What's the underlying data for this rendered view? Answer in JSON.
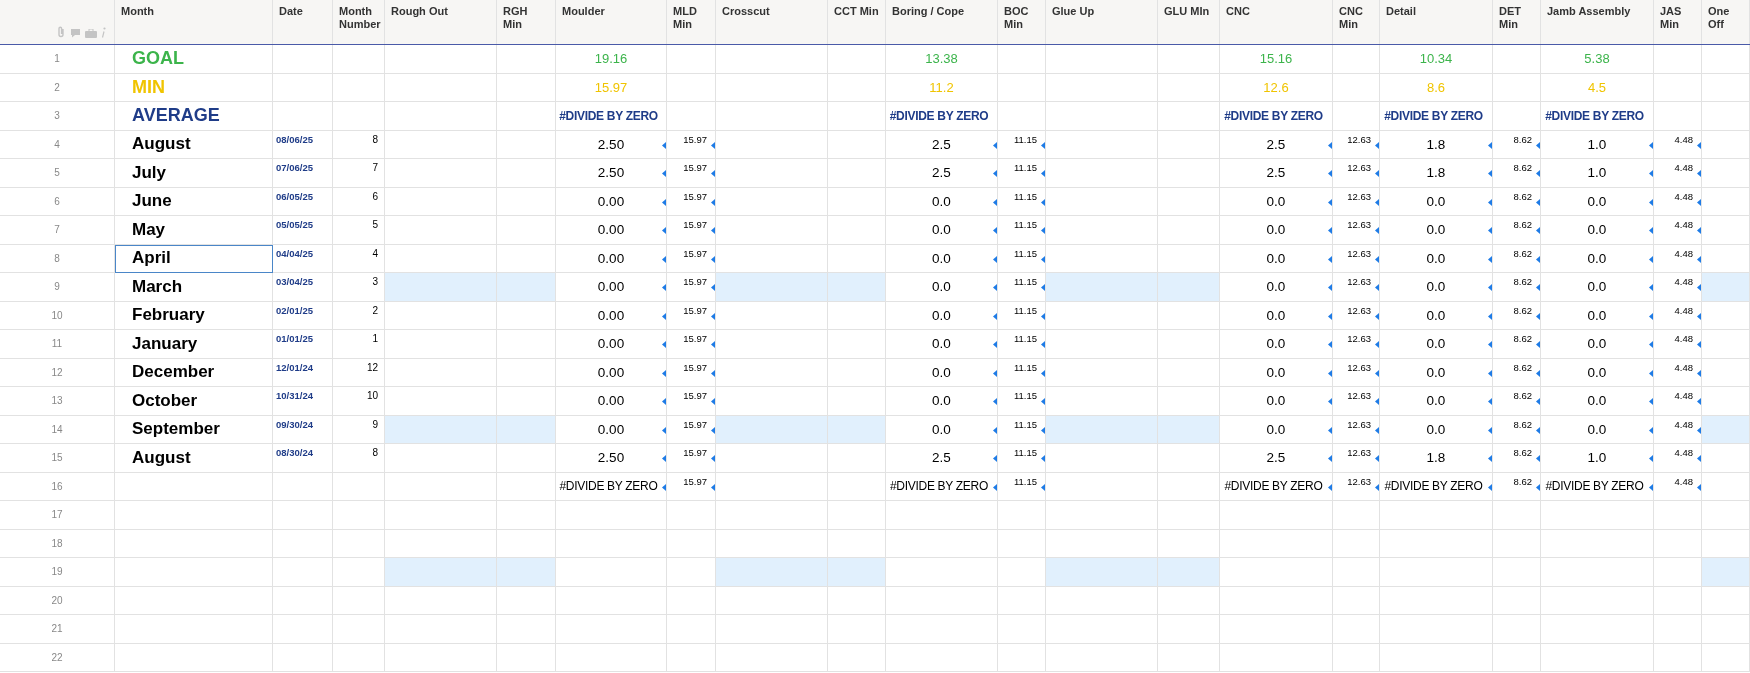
{
  "columns": [
    {
      "label": "Month",
      "kind": "month"
    },
    {
      "label": "Date",
      "kind": "date"
    },
    {
      "label": "Month Number",
      "kind": "number"
    },
    {
      "label": "Rough Out",
      "kind": "blank"
    },
    {
      "label": "RGH Min",
      "kind": "blank"
    },
    {
      "label": "Moulder",
      "kind": "process"
    },
    {
      "label": "MLD Min",
      "kind": "min"
    },
    {
      "label": "Crosscut",
      "kind": "blank"
    },
    {
      "label": "CCT Min",
      "kind": "blank"
    },
    {
      "label": "Boring / Cope",
      "kind": "process"
    },
    {
      "label": "BOC Min",
      "kind": "min"
    },
    {
      "label": "Glue Up",
      "kind": "blank"
    },
    {
      "label": "GLU MIn",
      "kind": "blank"
    },
    {
      "label": "CNC",
      "kind": "process"
    },
    {
      "label": "CNC Min",
      "kind": "min"
    },
    {
      "label": "Detail",
      "kind": "process"
    },
    {
      "label": "DET Min",
      "kind": "min"
    },
    {
      "label": "Jamb Assembly",
      "kind": "process"
    },
    {
      "label": "JAS Min",
      "kind": "min"
    },
    {
      "label": "One Off",
      "kind": "blank"
    }
  ],
  "rows": [
    {
      "number": "1",
      "kind": "goal",
      "highlighted": false,
      "linked": false,
      "selected": false,
      "cells": [
        "GOAL",
        null,
        null,
        null,
        null,
        "19.16",
        null,
        null,
        null,
        "13.38",
        null,
        null,
        null,
        "15.16",
        null,
        "10.34",
        null,
        "5.38",
        null,
        null
      ]
    },
    {
      "number": "2",
      "kind": "min",
      "highlighted": false,
      "linked": false,
      "selected": false,
      "cells": [
        "MIN",
        null,
        null,
        null,
        null,
        "15.97",
        null,
        null,
        null,
        "11.2",
        null,
        null,
        null,
        "12.6",
        null,
        "8.6",
        null,
        "4.5",
        null,
        null
      ]
    },
    {
      "number": "3",
      "kind": "average",
      "highlighted": false,
      "linked": false,
      "selected": false,
      "cells": [
        "AVERAGE",
        null,
        null,
        null,
        null,
        "#DIVIDE BY ZERO",
        null,
        null,
        null,
        "#DIVIDE BY ZERO",
        null,
        null,
        null,
        "#DIVIDE BY ZERO",
        null,
        "#DIVIDE BY ZERO",
        null,
        "#DIVIDE BY ZERO",
        null,
        null
      ]
    },
    {
      "number": "4",
      "kind": "month",
      "highlighted": false,
      "linked": true,
      "selected": false,
      "cells": [
        "August",
        "08/06/25",
        "8",
        null,
        null,
        "2.50",
        "15.97",
        null,
        null,
        "2.5",
        "11.15",
        null,
        null,
        "2.5",
        "12.63",
        "1.8",
        "8.62",
        "1.0",
        "4.48",
        null
      ]
    },
    {
      "number": "5",
      "kind": "month",
      "highlighted": false,
      "linked": true,
      "selected": false,
      "cells": [
        "July",
        "07/06/25",
        "7",
        null,
        null,
        "2.50",
        "15.97",
        null,
        null,
        "2.5",
        "11.15",
        null,
        null,
        "2.5",
        "12.63",
        "1.8",
        "8.62",
        "1.0",
        "4.48",
        null
      ]
    },
    {
      "number": "6",
      "kind": "month",
      "highlighted": false,
      "linked": true,
      "selected": false,
      "cells": [
        "June",
        "06/05/25",
        "6",
        null,
        null,
        "0.00",
        "15.97",
        null,
        null,
        "0.0",
        "11.15",
        null,
        null,
        "0.0",
        "12.63",
        "0.0",
        "8.62",
        "0.0",
        "4.48",
        null
      ]
    },
    {
      "number": "7",
      "kind": "month",
      "highlighted": false,
      "linked": true,
      "selected": false,
      "cells": [
        "May",
        "05/05/25",
        "5",
        null,
        null,
        "0.00",
        "15.97",
        null,
        null,
        "0.0",
        "11.15",
        null,
        null,
        "0.0",
        "12.63",
        "0.0",
        "8.62",
        "0.0",
        "4.48",
        null
      ]
    },
    {
      "number": "8",
      "kind": "month",
      "highlighted": false,
      "linked": true,
      "selected": true,
      "cells": [
        "April",
        "04/04/25",
        "4",
        null,
        null,
        "0.00",
        "15.97",
        null,
        null,
        "0.0",
        "11.15",
        null,
        null,
        "0.0",
        "12.63",
        "0.0",
        "8.62",
        "0.0",
        "4.48",
        null
      ]
    },
    {
      "number": "9",
      "kind": "month",
      "highlighted": true,
      "linked": true,
      "selected": false,
      "cells": [
        "March",
        "03/04/25",
        "3",
        null,
        null,
        "0.00",
        "15.97",
        null,
        null,
        "0.0",
        "11.15",
        null,
        null,
        "0.0",
        "12.63",
        "0.0",
        "8.62",
        "0.0",
        "4.48",
        null
      ]
    },
    {
      "number": "10",
      "kind": "month",
      "highlighted": false,
      "linked": true,
      "selected": false,
      "cells": [
        "February",
        "02/01/25",
        "2",
        null,
        null,
        "0.00",
        "15.97",
        null,
        null,
        "0.0",
        "11.15",
        null,
        null,
        "0.0",
        "12.63",
        "0.0",
        "8.62",
        "0.0",
        "4.48",
        null
      ]
    },
    {
      "number": "11",
      "kind": "month",
      "highlighted": false,
      "linked": true,
      "selected": false,
      "cells": [
        "January",
        "01/01/25",
        "1",
        null,
        null,
        "0.00",
        "15.97",
        null,
        null,
        "0.0",
        "11.15",
        null,
        null,
        "0.0",
        "12.63",
        "0.0",
        "8.62",
        "0.0",
        "4.48",
        null
      ]
    },
    {
      "number": "12",
      "kind": "month",
      "highlighted": false,
      "linked": true,
      "selected": false,
      "cells": [
        "December",
        "12/01/24",
        "12",
        null,
        null,
        "0.00",
        "15.97",
        null,
        null,
        "0.0",
        "11.15",
        null,
        null,
        "0.0",
        "12.63",
        "0.0",
        "8.62",
        "0.0",
        "4.48",
        null
      ]
    },
    {
      "number": "13",
      "kind": "month",
      "highlighted": false,
      "linked": true,
      "selected": false,
      "cells": [
        "October",
        "10/31/24",
        "10",
        null,
        null,
        "0.00",
        "15.97",
        null,
        null,
        "0.0",
        "11.15",
        null,
        null,
        "0.0",
        "12.63",
        "0.0",
        "8.62",
        "0.0",
        "4.48",
        null
      ]
    },
    {
      "number": "14",
      "kind": "month",
      "highlighted": true,
      "linked": true,
      "selected": false,
      "cells": [
        "September",
        "09/30/24",
        "9",
        null,
        null,
        "0.00",
        "15.97",
        null,
        null,
        "0.0",
        "11.15",
        null,
        null,
        "0.0",
        "12.63",
        "0.0",
        "8.62",
        "0.0",
        "4.48",
        null
      ]
    },
    {
      "number": "15",
      "kind": "month",
      "highlighted": false,
      "linked": true,
      "selected": false,
      "cells": [
        "August",
        "08/30/24",
        "8",
        null,
        null,
        "2.50",
        "15.97",
        null,
        null,
        "2.5",
        "11.15",
        null,
        null,
        "2.5",
        "12.63",
        "1.8",
        "8.62",
        "1.0",
        "4.48",
        null
      ]
    },
    {
      "number": "16",
      "kind": "month",
      "highlighted": false,
      "linked": true,
      "selected": false,
      "cells": [
        null,
        null,
        null,
        null,
        null,
        "#DIVIDE BY ZERO",
        "15.97",
        null,
        null,
        "#DIVIDE BY ZERO",
        "11.15",
        null,
        null,
        "#DIVIDE BY ZERO",
        "12.63",
        "#DIVIDE BY ZERO",
        "8.62",
        "#DIVIDE BY ZERO",
        "4.48",
        null
      ]
    },
    {
      "number": "17",
      "kind": "month",
      "highlighted": false,
      "linked": false,
      "selected": false
    },
    {
      "number": "18",
      "kind": "month",
      "highlighted": false,
      "linked": false,
      "selected": false
    },
    {
      "number": "19",
      "kind": "month",
      "highlighted": true,
      "linked": false,
      "selected": false
    },
    {
      "number": "20",
      "kind": "month",
      "highlighted": false,
      "linked": false,
      "selected": false
    },
    {
      "number": "21",
      "kind": "month",
      "highlighted": false,
      "linked": false,
      "selected": false
    },
    {
      "number": "22",
      "kind": "month",
      "highlighted": false,
      "linked": false,
      "selected": false
    }
  ]
}
